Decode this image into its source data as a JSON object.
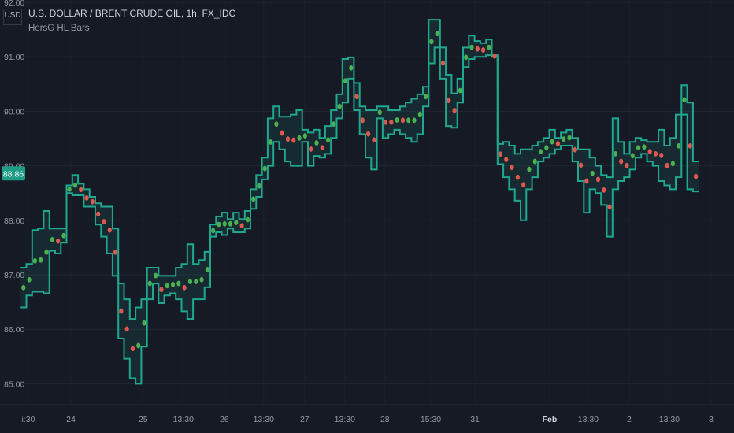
{
  "header": {
    "symbol_title": "U.S. DOLLAR / BRENT CRUDE OIL, 1h, FX_IDC",
    "indicator": "HersG HL Bars",
    "currency": "USD"
  },
  "colors": {
    "background": "#161a25",
    "grid": "#222631",
    "line": "#1fa88f",
    "fill": "#1fa88f",
    "up_dot": "#4caf50",
    "down_dot": "#e0574f",
    "last_price_bg": "#1e9c86"
  },
  "chart_data": {
    "type": "line",
    "title": "U.S. DOLLAR / BRENT CRUDE OIL, 1h, FX_IDC",
    "ylabel": "USD",
    "xlabel": "",
    "ylim": [
      84.7,
      92.05
    ],
    "xlim": [
      -0.65,
      8.25
    ],
    "x_units": "trading days from 24 Jan",
    "x_range": [
      -0.59,
      7.78
    ],
    "grid": true,
    "last_price": "88.86",
    "last_price_value": 88.86,
    "yticks": [
      {
        "value": 92,
        "label": "92.00"
      },
      {
        "value": 91,
        "label": "91.00"
      },
      {
        "value": 90,
        "label": "90.00"
      },
      {
        "value": 89,
        "label": "89.00"
      },
      {
        "value": 88,
        "label": "88.00"
      },
      {
        "value": 87,
        "label": "87.00"
      },
      {
        "value": 86,
        "label": "86.00"
      },
      {
        "value": 85,
        "label": "85.00"
      }
    ],
    "xticks": [
      {
        "value": -0.53,
        "label": "i:30",
        "bold": false
      },
      {
        "value": 0,
        "label": "24",
        "bold": false
      },
      {
        "value": 0.9,
        "label": "25",
        "bold": false
      },
      {
        "value": 1.4,
        "label": "13:30",
        "bold": false
      },
      {
        "value": 1.91,
        "label": "26",
        "bold": false
      },
      {
        "value": 2.4,
        "label": "13:30",
        "bold": false
      },
      {
        "value": 2.91,
        "label": "27",
        "bold": false
      },
      {
        "value": 3.41,
        "label": "13:30",
        "bold": false
      },
      {
        "value": 3.91,
        "label": "28",
        "bold": false
      },
      {
        "value": 4.48,
        "label": "15:30",
        "bold": false
      },
      {
        "value": 5.03,
        "label": "31",
        "bold": false
      },
      {
        "value": 5.96,
        "label": "Feb",
        "bold": true
      },
      {
        "value": 6.44,
        "label": "13:30",
        "bold": false
      },
      {
        "value": 6.95,
        "label": "2",
        "bold": false
      },
      {
        "value": 7.45,
        "label": "13:30",
        "bold": false
      },
      {
        "value": 7.97,
        "label": "3",
        "bold": false
      }
    ],
    "series": [
      {
        "name": "High",
        "values": [
          87.13,
          87.2,
          87.82,
          87.85,
          88.17,
          87.85,
          87.85,
          87.85,
          88.64,
          88.83,
          88.67,
          88.57,
          88.43,
          88.31,
          88.25,
          88.25,
          87.85,
          86.84,
          86.55,
          86.19,
          86.4,
          86.55,
          87.13,
          87.13,
          86.98,
          86.98,
          86.98,
          87.13,
          87.2,
          87.56,
          87.2,
          87.27,
          87.42,
          87.92,
          88.07,
          88.14,
          88.02,
          88.14,
          88.02,
          88.17,
          88.57,
          88.83,
          89.15,
          89.87,
          90.09,
          89.9,
          89.9,
          89.94,
          90.02,
          89.66,
          89.61,
          89.66,
          89.51,
          89.73,
          90.02,
          90.31,
          90.96,
          90.99,
          90.52,
          90.09,
          90.02,
          90.02,
          90.09,
          90.09,
          90.02,
          90.02,
          90.09,
          90.16,
          90.23,
          90.31,
          90.45,
          91.68,
          91.68,
          91.17,
          90.67,
          90.33,
          90.6,
          91.17,
          91.39,
          91.29,
          91.25,
          91.32,
          91.03,
          89.4,
          89.44,
          89.37,
          89.22,
          89.3,
          89.3,
          89.37,
          89.44,
          89.51,
          89.66,
          89.51,
          89.61,
          89.66,
          89.51,
          89.3,
          89.3,
          89.15,
          89.0,
          88.83,
          88.79,
          89.87,
          89.44,
          89.22,
          89.44,
          89.51,
          89.47,
          89.44,
          89.44,
          89.66,
          89.37,
          89.51,
          89.94,
          90.48,
          90.16,
          89.08
        ]
      },
      {
        "name": "Low",
        "values": [
          86.4,
          86.62,
          86.69,
          86.69,
          86.66,
          87.44,
          87.39,
          87.59,
          88.5,
          88.46,
          88.46,
          88.25,
          88.25,
          87.92,
          87.7,
          87.39,
          86.98,
          85.83,
          85.46,
          85.1,
          85.0,
          85.68,
          86.55,
          86.84,
          86.48,
          86.62,
          86.66,
          86.55,
          86.33,
          86.19,
          86.55,
          86.55,
          86.77,
          87.7,
          87.78,
          87.73,
          87.85,
          87.78,
          87.78,
          87.85,
          88.21,
          88.43,
          88.75,
          89.0,
          89.44,
          89.3,
          89.08,
          89.0,
          89.0,
          89.44,
          89.0,
          89.18,
          89.15,
          89.22,
          89.51,
          89.87,
          90.16,
          90.6,
          90.02,
          89.58,
          89.15,
          88.93,
          89.87,
          89.51,
          89.58,
          89.66,
          89.58,
          89.51,
          89.44,
          89.58,
          90.09,
          90.88,
          91.17,
          90.6,
          89.73,
          89.7,
          90.16,
          90.81,
          90.96,
          91.0,
          91.0,
          91.03,
          91.0,
          89.03,
          88.79,
          88.57,
          88.36,
          88.0,
          88.57,
          88.79,
          89.08,
          89.15,
          89.22,
          89.3,
          89.37,
          89.37,
          89.08,
          88.72,
          88.14,
          88.57,
          88.5,
          88.28,
          87.7,
          88.57,
          88.72,
          88.79,
          88.93,
          89.15,
          89.22,
          89.08,
          89.0,
          88.72,
          88.64,
          88.57,
          88.79,
          89.94,
          88.57,
          88.53
        ]
      }
    ]
  }
}
